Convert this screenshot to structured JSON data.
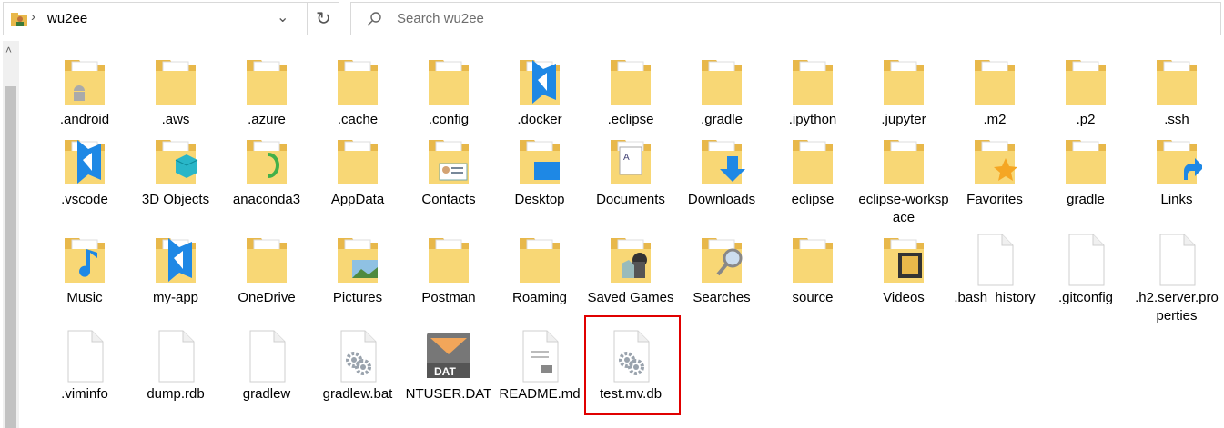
{
  "address": {
    "path": "wu2ee"
  },
  "search": {
    "placeholder": "Search wu2ee"
  },
  "items": [
    {
      "label": ".android",
      "icon": "folder-android-icon"
    },
    {
      "label": ".aws",
      "icon": "folder-icon"
    },
    {
      "label": ".azure",
      "icon": "folder-icon"
    },
    {
      "label": ".cache",
      "icon": "folder-icon"
    },
    {
      "label": ".config",
      "icon": "folder-icon"
    },
    {
      "label": ".docker",
      "icon": "folder-vscode-icon"
    },
    {
      "label": ".eclipse",
      "icon": "folder-icon"
    },
    {
      "label": ".gradle",
      "icon": "folder-icon"
    },
    {
      "label": ".ipython",
      "icon": "folder-icon"
    },
    {
      "label": ".jupyter",
      "icon": "folder-icon"
    },
    {
      "label": ".m2",
      "icon": "folder-icon"
    },
    {
      "label": ".p2",
      "icon": "folder-icon"
    },
    {
      "label": ".ssh",
      "icon": "folder-icon"
    },
    {
      "label": ".vscode",
      "icon": "folder-vscode-icon"
    },
    {
      "label": "3D Objects",
      "icon": "folder-3d-icon"
    },
    {
      "label": "anaconda3",
      "icon": "folder-anaconda-icon"
    },
    {
      "label": "AppData",
      "icon": "folder-icon"
    },
    {
      "label": "Contacts",
      "icon": "folder-contacts-icon"
    },
    {
      "label": "Desktop",
      "icon": "folder-desktop-icon"
    },
    {
      "label": "Documents",
      "icon": "folder-documents-icon"
    },
    {
      "label": "Downloads",
      "icon": "folder-downloads-icon"
    },
    {
      "label": "eclipse",
      "icon": "folder-icon"
    },
    {
      "label": "eclipse-workspace",
      "icon": "folder-icon"
    },
    {
      "label": "Favorites",
      "icon": "folder-favorites-icon"
    },
    {
      "label": "gradle",
      "icon": "folder-icon"
    },
    {
      "label": "Links",
      "icon": "folder-links-icon"
    },
    {
      "label": "Music",
      "icon": "folder-music-icon"
    },
    {
      "label": "my-app",
      "icon": "folder-vscode-icon"
    },
    {
      "label": "OneDrive",
      "icon": "folder-icon"
    },
    {
      "label": "Pictures",
      "icon": "folder-pictures-icon"
    },
    {
      "label": "Postman",
      "icon": "folder-icon"
    },
    {
      "label": "Roaming",
      "icon": "folder-icon"
    },
    {
      "label": "Saved Games",
      "icon": "folder-saved-games-icon"
    },
    {
      "label": "Searches",
      "icon": "folder-searches-icon"
    },
    {
      "label": "source",
      "icon": "folder-icon"
    },
    {
      "label": "Videos",
      "icon": "folder-videos-icon"
    },
    {
      "label": ".bash_history",
      "icon": "file-icon"
    },
    {
      "label": ".gitconfig",
      "icon": "file-icon"
    },
    {
      "label": ".h2.server.properties",
      "icon": "file-icon"
    },
    {
      "label": ".viminfo",
      "icon": "file-icon"
    },
    {
      "label": "dump.rdb",
      "icon": "file-icon"
    },
    {
      "label": "gradlew",
      "icon": "file-icon"
    },
    {
      "label": "gradlew.bat",
      "icon": "file-settings-icon"
    },
    {
      "label": "NTUSER.DAT",
      "icon": "file-dat-icon"
    },
    {
      "label": "README.md",
      "icon": "file-markdown-icon"
    },
    {
      "label": "test.mv.db",
      "icon": "file-settings-icon"
    }
  ],
  "colors": {
    "folder": "#f8d775",
    "folder_dark": "#e8b84a",
    "accent_blue": "#1e88e5",
    "highlight": "#e00000"
  }
}
